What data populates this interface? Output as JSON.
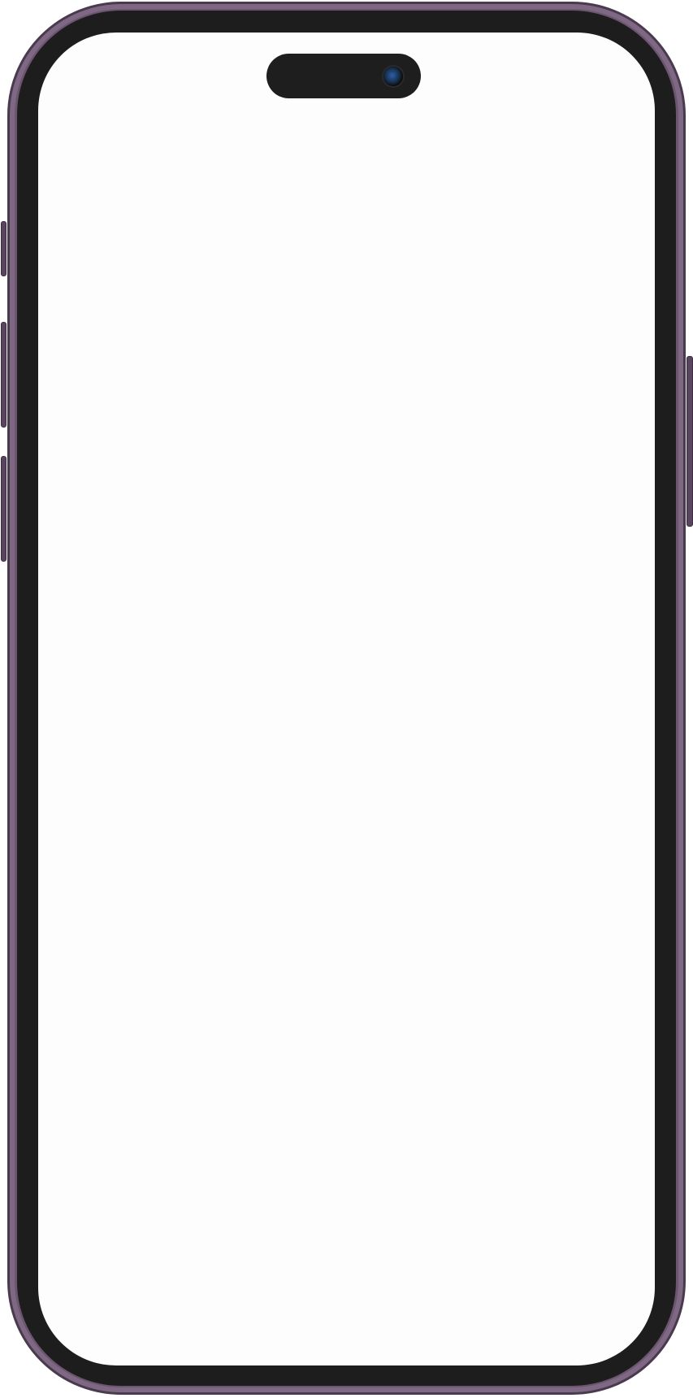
{
  "device": {
    "model_description": "",
    "frame_color": "#6b556f",
    "bezel_color": "#1d1d1d",
    "screen_color": "#fdfdfd",
    "screen_content": "",
    "icons": [
      "camera-icon"
    ]
  }
}
